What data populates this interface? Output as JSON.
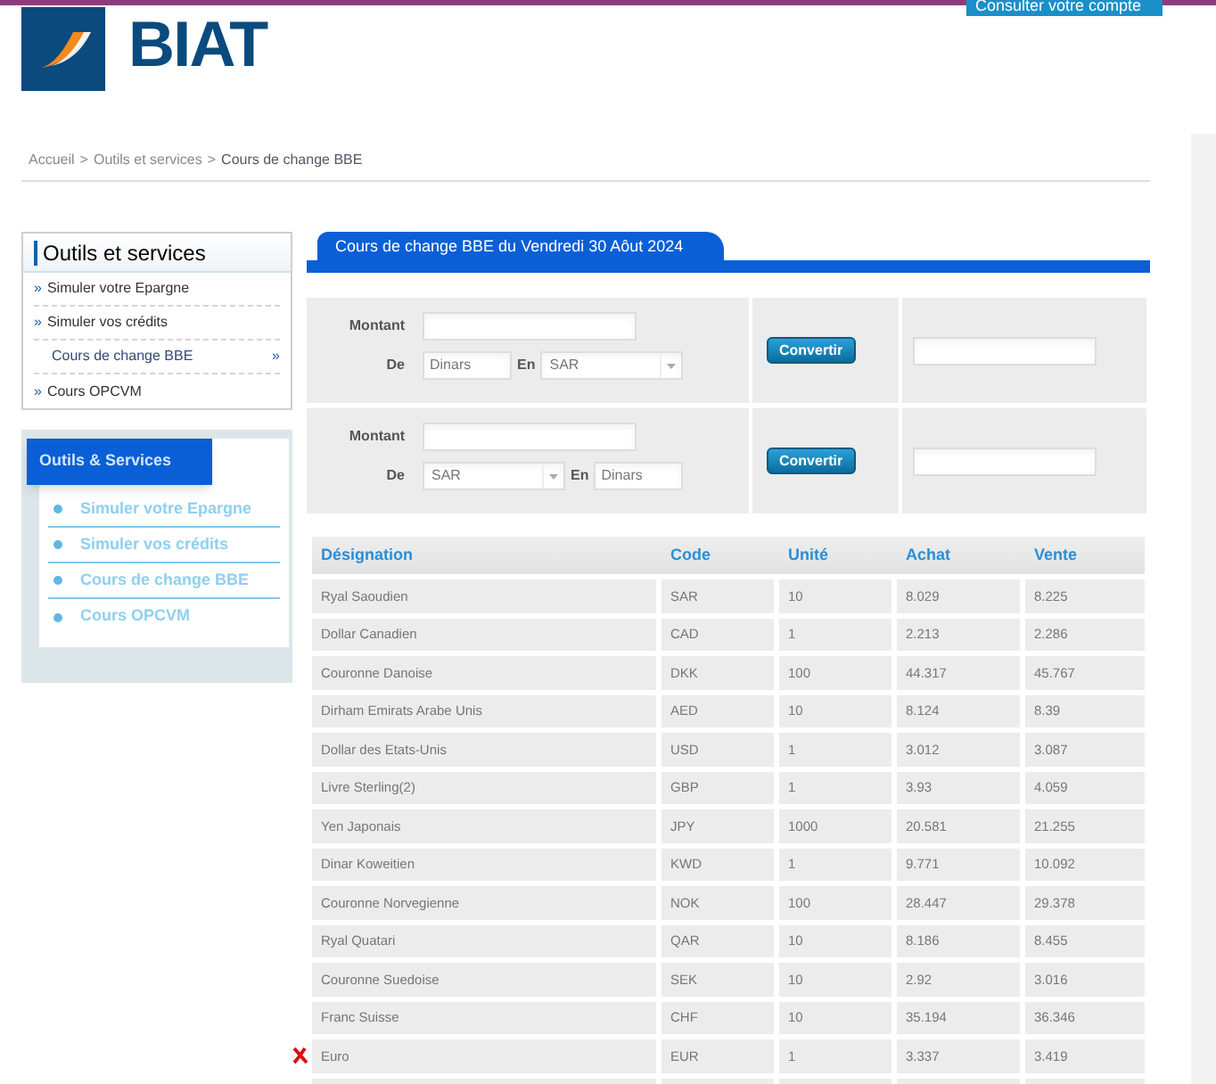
{
  "header": {
    "logo_text": "BIAT",
    "account_button": "Consulter votre compte"
  },
  "breadcrumb": [
    {
      "label": "Accueil",
      "selected": false
    },
    {
      "label": "Outils et services",
      "selected": false
    },
    {
      "label": "Cours de change BBE",
      "selected": true
    }
  ],
  "breadcrumb_separator": ">",
  "sidebar": {
    "title": "Outils et services",
    "items": [
      {
        "label": "Simuler votre Epargne",
        "selected": false
      },
      {
        "label": "Simuler vos crédits",
        "selected": false
      },
      {
        "label": "Cours de change BBE",
        "selected": true
      },
      {
        "label": "Cours OPCVM",
        "selected": false
      }
    ],
    "bullet": "»"
  },
  "services_box": {
    "title": "Outils & Services",
    "items": [
      "Simuler votre Epargne",
      "Simuler vos crédits",
      "Cours de change BBE",
      "Cours OPCVM"
    ]
  },
  "main_title": "Cours de change BBE du Vendredi 30 Aôut 2024",
  "converters": [
    {
      "amount_label": "Montant",
      "from_label": "De",
      "to_label": "En",
      "from": {
        "kind": "text",
        "value": "Dinars"
      },
      "to": {
        "kind": "select",
        "value": "SAR"
      },
      "button": "Convertir"
    },
    {
      "amount_label": "Montant",
      "from_label": "De",
      "to_label": "En",
      "from": {
        "kind": "select",
        "value": "SAR"
      },
      "to": {
        "kind": "text",
        "value": "Dinars"
      },
      "button": "Convertir"
    }
  ],
  "table": {
    "columns": [
      "Désignation",
      "Code",
      "Unité",
      "Achat",
      "Vente"
    ],
    "rows": [
      {
        "cells": [
          "Ryal Saoudien",
          "SAR",
          "10",
          "8.029",
          "8.225"
        ],
        "marked": false
      },
      {
        "cells": [
          "Dollar Canadien",
          "CAD",
          "1",
          "2.213",
          "2.286"
        ],
        "marked": false
      },
      {
        "cells": [
          "Couronne Danoise",
          "DKK",
          "100",
          "44.317",
          "45.767"
        ],
        "marked": false
      },
      {
        "cells": [
          "Dirham Emirats Arabe Unis",
          "AED",
          "10",
          "8.124",
          "8.39"
        ],
        "marked": false
      },
      {
        "cells": [
          "Dollar des Etats-Unis",
          "USD",
          "1",
          "3.012",
          "3.087"
        ],
        "marked": false
      },
      {
        "cells": [
          "Livre Sterling(2)",
          "GBP",
          "1",
          "3.93",
          "4.059"
        ],
        "marked": false
      },
      {
        "cells": [
          "Yen Japonais",
          "JPY",
          "1000",
          "20.581",
          "21.255"
        ],
        "marked": false
      },
      {
        "cells": [
          "Dinar Koweitien",
          "KWD",
          "1",
          "9.771",
          "10.092"
        ],
        "marked": false
      },
      {
        "cells": [
          "Couronne Norvegienne",
          "NOK",
          "100",
          "28.447",
          "29.378"
        ],
        "marked": false
      },
      {
        "cells": [
          "Ryal Quatari",
          "QAR",
          "10",
          "8.186",
          "8.455"
        ],
        "marked": false
      },
      {
        "cells": [
          "Couronne Suedoise",
          "SEK",
          "10",
          "2.92",
          "3.016"
        ],
        "marked": false
      },
      {
        "cells": [
          "Franc Suisse",
          "CHF",
          "10",
          "35.194",
          "36.346"
        ],
        "marked": false
      },
      {
        "cells": [
          "Euro",
          "EUR",
          "1",
          "3.337",
          "3.419"
        ],
        "marked": true
      }
    ]
  }
}
